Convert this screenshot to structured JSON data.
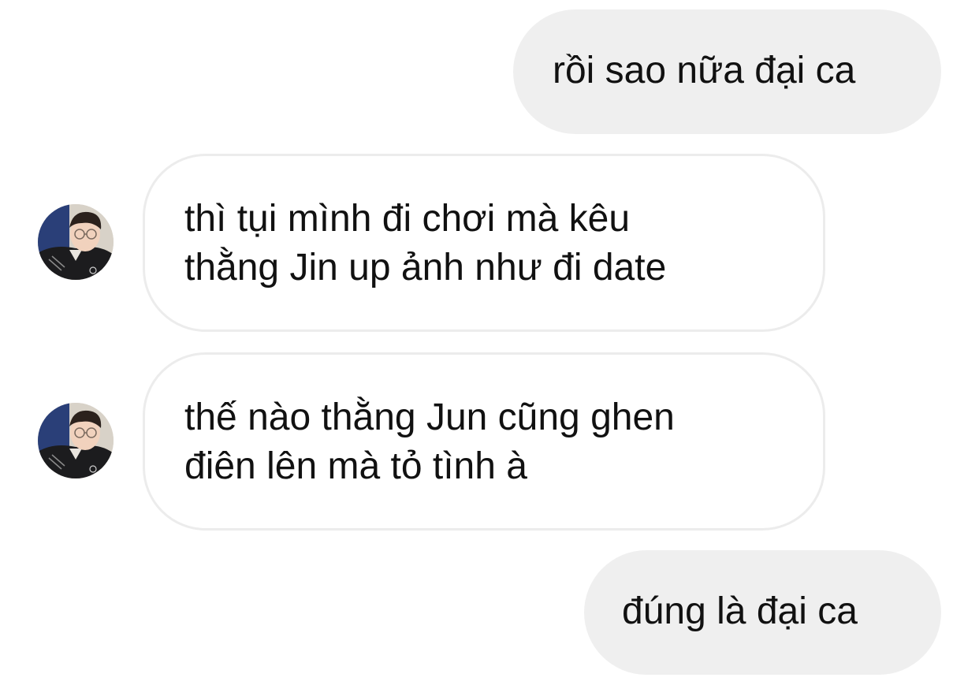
{
  "conversation": {
    "messages": [
      {
        "side": "sent",
        "lines": [
          "rồi sao nữa đại ca"
        ]
      },
      {
        "side": "received",
        "lines": [
          "thì tụi mình đi chơi mà kêu",
          "thằng Jin up ảnh như đi date"
        ]
      },
      {
        "side": "received",
        "lines": [
          "thế nào thằng Jun cũng ghen",
          "điên lên mà tỏ tình à"
        ]
      },
      {
        "side": "sent",
        "lines": [
          "đúng là đại ca"
        ]
      }
    ]
  },
  "colors": {
    "background": "#ffffff",
    "sent_bubble": "#efefef",
    "received_bubble_border": "#ececec",
    "text": "#111111"
  },
  "icons": {
    "avatar": "profile-photo"
  }
}
